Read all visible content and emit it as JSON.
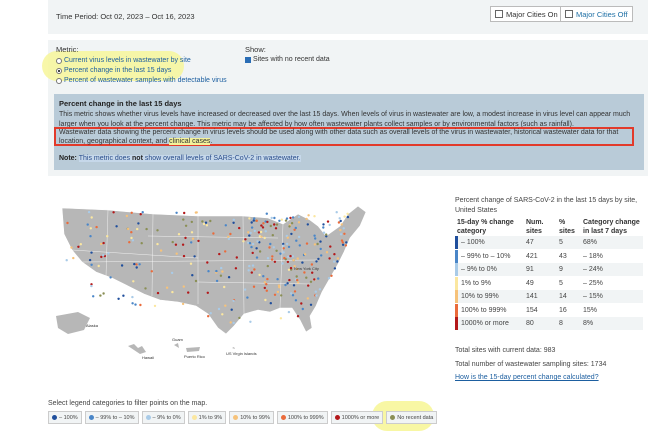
{
  "header": {
    "time_period": "Time Period: Oct 02, 2023 – Oct 16, 2023",
    "btn_on": "Major Cities On",
    "btn_off": "Major Cities Off"
  },
  "metric": {
    "title": "Metric:",
    "options": [
      {
        "label": "Current virus levels in wastewater by site",
        "selected": false
      },
      {
        "label": "Percent change in the last 15 days",
        "selected": true
      },
      {
        "label": "Percent of wastewater samples with detectable virus",
        "selected": false
      }
    ],
    "show_title": "Show:",
    "show_option": "Sites with no recent data",
    "show_checked": true
  },
  "description": {
    "title": "Percent change in the last 15 days",
    "paragraph": "This metric shows whether virus levels have increased or decreased over the last 15 days. When levels of virus in wastewater are low, a modest increase in virus level can appear much larger when you look at the percent change. This metric may be affected by how often wastewater plants collect samples or by environmental factors (such as rainfall).",
    "boxed_text": "Wastewater data showing the percent change in virus levels should be used along with other data such as overall levels of the virus in wastewater, historical wastewater data for that location, geographical context, and",
    "boxed_link": "clinical cases",
    "boxed_end": ".",
    "note_label": "Note:",
    "note_pre": "This metric does",
    "note_bold": "not",
    "note_post": "show overall levels of SARS-CoV-2 in wastewater."
  },
  "map": {
    "labels": {
      "alaska": "Alaska",
      "hawaii": "Hawaii",
      "guam": "Guam",
      "puerto_rico": "Puerto Rico",
      "virgin_islands": "US Virgin Islands",
      "nyc": "New York City"
    }
  },
  "legend": {
    "caption": "Percent change of SARS-CoV-2 in the last 15 days by site, United States",
    "headers": [
      "15-day % change category",
      "Num. sites",
      "% sites",
      "Category change in last 7 days"
    ],
    "rows": [
      {
        "category": "– 100%",
        "num": "47",
        "pct": "5",
        "change": "68%",
        "color": "#1f4e9c"
      },
      {
        "category": "– 99% to – 10%",
        "num": "421",
        "pct": "43",
        "change": "– 18%",
        "color": "#4a86c8"
      },
      {
        "category": "– 9% to 0%",
        "num": "91",
        "pct": "9",
        "change": "– 24%",
        "color": "#a9cbe8"
      },
      {
        "category": "1% to 9%",
        "num": "49",
        "pct": "5",
        "change": "– 25%",
        "color": "#fbe7a0"
      },
      {
        "category": "10% to 99%",
        "num": "141",
        "pct": "14",
        "change": "– 15%",
        "color": "#f6c27a"
      },
      {
        "category": "100% to 999%",
        "num": "154",
        "pct": "16",
        "change": "15%",
        "color": "#ea6b3b"
      },
      {
        "category": "1000% or more",
        "num": "80",
        "pct": "8",
        "change": "8%",
        "color": "#b3181a"
      }
    ],
    "total_current": "Total sites with current data: 983",
    "total_all": "Total number of wastewater sampling sites: 1734",
    "link": "How is the 15-day percent change calculated?"
  },
  "filter": {
    "title": "Select legend categories to filter points on the map.",
    "chips": [
      {
        "label": "– 100%",
        "color": "#1f4e9c"
      },
      {
        "label": "– 99% to – 10%",
        "color": "#4a86c8"
      },
      {
        "label": "– 9% to 0%",
        "color": "#a9cbe8"
      },
      {
        "label": "1% to 9%",
        "color": "#fbe7a0"
      },
      {
        "label": "10% to 99%",
        "color": "#f6c27a"
      },
      {
        "label": "100% to 999%",
        "color": "#ea6b3b"
      },
      {
        "label": "1000% or more",
        "color": "#b3181a"
      },
      {
        "label": "No recent data",
        "color": "#8a8f55"
      }
    ]
  },
  "colors": {
    "panel_bg": "#f1f4f5",
    "desc_bg": "#b9cbd8",
    "highlight": "#f7f69a",
    "red_box": "#e23a2a",
    "map_fill": "#b7b7b7"
  }
}
